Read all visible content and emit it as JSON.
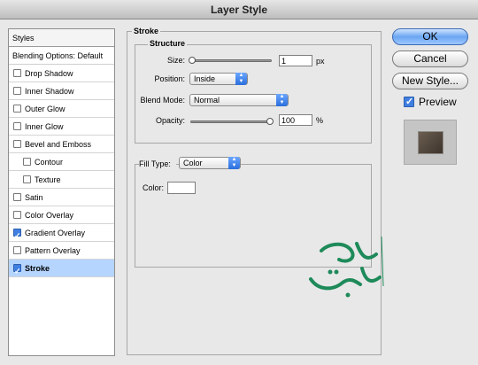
{
  "window": {
    "title": "Layer Style"
  },
  "sidebar": {
    "header": "Styles",
    "blending": "Blending Options: Default",
    "items": [
      {
        "label": "Drop Shadow",
        "checked": false,
        "sub": false,
        "selected": false
      },
      {
        "label": "Inner Shadow",
        "checked": false,
        "sub": false,
        "selected": false
      },
      {
        "label": "Outer Glow",
        "checked": false,
        "sub": false,
        "selected": false
      },
      {
        "label": "Inner Glow",
        "checked": false,
        "sub": false,
        "selected": false
      },
      {
        "label": "Bevel and Emboss",
        "checked": false,
        "sub": false,
        "selected": false
      },
      {
        "label": "Contour",
        "checked": false,
        "sub": true,
        "selected": false
      },
      {
        "label": "Texture",
        "checked": false,
        "sub": true,
        "selected": false
      },
      {
        "label": "Satin",
        "checked": false,
        "sub": false,
        "selected": false
      },
      {
        "label": "Color Overlay",
        "checked": false,
        "sub": false,
        "selected": false
      },
      {
        "label": "Gradient Overlay",
        "checked": true,
        "sub": false,
        "selected": false
      },
      {
        "label": "Pattern Overlay",
        "checked": false,
        "sub": false,
        "selected": false
      },
      {
        "label": "Stroke",
        "checked": true,
        "sub": false,
        "selected": true
      }
    ]
  },
  "stroke": {
    "title": "Stroke",
    "structure_title": "Structure",
    "size_label": "Size:",
    "size_value": "1",
    "size_unit": "px",
    "size_level": 0.0,
    "position_label": "Position:",
    "position_value": "Inside",
    "blend_label": "Blend Mode:",
    "blend_value": "Normal",
    "opacity_label": "Opacity:",
    "opacity_value": "100",
    "opacity_unit": "%",
    "opacity_level": 1.0,
    "fill_label": "Fill Type:",
    "fill_value": "Color",
    "color_label": "Color:",
    "color_value": "#ffffff"
  },
  "buttons": {
    "ok": "OK",
    "cancel": "Cancel",
    "new_style": "New Style...",
    "preview": "Preview",
    "preview_checked": true
  },
  "colors": {
    "accent": "#3f7fe0",
    "selected_row": "#b5d5ff",
    "watermark": "#1e8a5a"
  }
}
